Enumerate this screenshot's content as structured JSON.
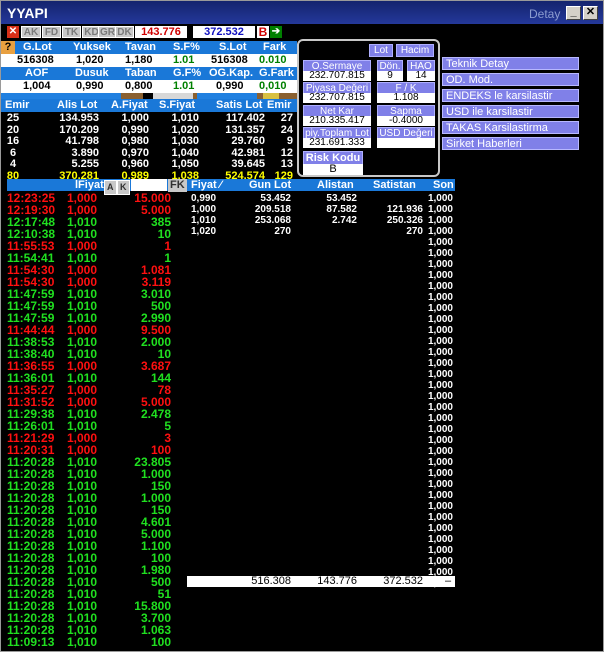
{
  "title": {
    "symbol": "YYAPI",
    "detail": "Detay"
  },
  "toolbar": {
    "x": "✕",
    "tabs": [
      "AK",
      "FD",
      "TK",
      "KD",
      "GR",
      "DK"
    ],
    "last_volume": "143.776",
    "last_value": "372.532",
    "b": "B",
    "arrow": "➔"
  },
  "summary": {
    "row1_headers": [
      "G.Lot",
      "Yuksek",
      "Tavan",
      "S.F%",
      "S.Lot",
      "Fark"
    ],
    "row1_values": [
      "516308",
      "1,020",
      "1,180",
      "1.01",
      "516308",
      "0.010"
    ],
    "row2_headers": [
      "AOF",
      "Dusuk",
      "Taban",
      "G.F%",
      "OG.Kap.",
      "G.Fark"
    ],
    "row2_values": [
      "1,004",
      "0,990",
      "0,800",
      "1.01",
      "0,990",
      "0,010"
    ],
    "help_icon": "?"
  },
  "depth": {
    "headers": [
      "Emir",
      "Alis Lot",
      "A.Fiyat",
      "S.Fiyat",
      "Satis Lot",
      "Emir"
    ],
    "rows": [
      [
        "25",
        "134.953",
        "1,000",
        "1,010",
        "117.402",
        "27"
      ],
      [
        "20",
        "170.209",
        "0,990",
        "1,020",
        "131.357",
        "24"
      ],
      [
        "16",
        "41.798",
        "0,980",
        "1,030",
        "29.760",
        "9"
      ],
      [
        "6",
        "3.890",
        "0,970",
        "1,040",
        "42.981",
        "12"
      ],
      [
        "4",
        "5.255",
        "0,960",
        "1,050",
        "39.645",
        "13"
      ]
    ],
    "total": [
      "80",
      "370.281",
      "0,989",
      "1,038",
      "524.574",
      "129"
    ]
  },
  "panel": {
    "lot": "Lot",
    "hacim": "Hacim",
    "osermaye_label": "O.Sermaye",
    "osermaye_value": "232.707.815",
    "don_label": "Dön.",
    "don_value": "9",
    "hao_label": "HAO",
    "hao_value": "14",
    "piyasa_label": "Piyasa Değeri",
    "piyasa_value": "232.707.815",
    "fk_label": "F / K",
    "fk_value": "1.108",
    "netkar_label": "Net Kar",
    "netkar_value": "210.335.417",
    "sapma_label": "Sapma",
    "sapma_value": "-0.4000",
    "toplam_label": "piy.Toplam Lot",
    "toplam_value": "231.691.333",
    "usd_label": "USD Değeri",
    "usd_value": "",
    "risk_label": "Risk Kodu",
    "risk_value": "B"
  },
  "menu": [
    "Teknik Detay",
    "OD. Mod.",
    "ENDEKS le karsilastir",
    "USD ile karsilastir",
    "TAKAS Karsilastirma",
    "Sirket Haberleri"
  ],
  "trades": {
    "headers": {
      "fiyat": "lFiyat",
      "a": "A",
      "k": "K",
      "fk": "FK"
    },
    "rows": [
      [
        "12:23:25",
        "1,000",
        "15.000",
        "red"
      ],
      [
        "12:19:30",
        "1,000",
        "5.000",
        "red"
      ],
      [
        "12:17:48",
        "1,010",
        "385",
        "green"
      ],
      [
        "12:10:38",
        "1,010",
        "10",
        "green"
      ],
      [
        "11:55:53",
        "1,000",
        "1",
        "red"
      ],
      [
        "11:54:41",
        "1,010",
        "1",
        "green"
      ],
      [
        "11:54:30",
        "1,000",
        "1.081",
        "red"
      ],
      [
        "11:54:30",
        "1,000",
        "3.119",
        "red"
      ],
      [
        "11:47:59",
        "1,010",
        "3.010",
        "green"
      ],
      [
        "11:47:59",
        "1,010",
        "500",
        "green"
      ],
      [
        "11:47:59",
        "1,010",
        "2.990",
        "green"
      ],
      [
        "11:44:44",
        "1,000",
        "9.500",
        "red"
      ],
      [
        "11:38:53",
        "1,010",
        "2.000",
        "green"
      ],
      [
        "11:38:40",
        "1,010",
        "10",
        "green"
      ],
      [
        "11:36:55",
        "1,000",
        "3.687",
        "red"
      ],
      [
        "11:36:01",
        "1,010",
        "144",
        "green"
      ],
      [
        "11:35:27",
        "1,000",
        "78",
        "red"
      ],
      [
        "11:31:52",
        "1,000",
        "5.000",
        "red"
      ],
      [
        "11:29:38",
        "1,010",
        "2.478",
        "green"
      ],
      [
        "11:26:01",
        "1,010",
        "5",
        "green"
      ],
      [
        "11:21:29",
        "1,000",
        "3",
        "red"
      ],
      [
        "11:20:31",
        "1,000",
        "100",
        "red"
      ],
      [
        "11:20:28",
        "1,010",
        "23.805",
        "green"
      ],
      [
        "11:20:28",
        "1,010",
        "1.000",
        "green"
      ],
      [
        "11:20:28",
        "1,010",
        "150",
        "green"
      ],
      [
        "11:20:28",
        "1,010",
        "1.000",
        "green"
      ],
      [
        "11:20:28",
        "1,010",
        "150",
        "green"
      ],
      [
        "11:20:28",
        "1,010",
        "4.601",
        "green"
      ],
      [
        "11:20:28",
        "1,010",
        "5.000",
        "green"
      ],
      [
        "11:20:28",
        "1,010",
        "1.100",
        "green"
      ],
      [
        "11:20:28",
        "1,010",
        "100",
        "green"
      ],
      [
        "11:20:28",
        "1,010",
        "1.980",
        "green"
      ],
      [
        "11:20:28",
        "1,010",
        "500",
        "green"
      ],
      [
        "11:20:28",
        "1,010",
        "51",
        "green"
      ],
      [
        "11:20:28",
        "1,010",
        "15.800",
        "green"
      ],
      [
        "11:20:28",
        "1,010",
        "3.700",
        "green"
      ],
      [
        "11:20:28",
        "1,010",
        "1.063",
        "green"
      ],
      [
        "11:09:13",
        "1,010",
        "100",
        "green"
      ]
    ]
  },
  "price_table": {
    "headers": [
      "Fiyat ⁄",
      "Gun Lot",
      "Alistan",
      "Satistan",
      "Son"
    ],
    "rows": [
      [
        "0,990",
        "53.452",
        "53.452",
        "",
        "1,000"
      ],
      [
        "1,000",
        "209.518",
        "87.582",
        "121.936",
        "1,000"
      ],
      [
        "1,010",
        "253.068",
        "2.742",
        "250.326",
        "1,000"
      ],
      [
        "1,020",
        "270",
        "",
        "270",
        "1,000"
      ]
    ],
    "son_extra": [
      "1,000",
      "1,000",
      "1,000",
      "1,000",
      "1,000",
      "1,000",
      "1,000",
      "1,000",
      "1,000",
      "1,000",
      "1,000",
      "1,000",
      "1,000",
      "1,000",
      "1,000",
      "1,000",
      "1,000",
      "1,000",
      "1,000",
      "1,000",
      "1,000",
      "1,000",
      "1,000",
      "1,000",
      "1,000",
      "1,000",
      "1,000",
      "1,000",
      "1,000",
      "1,000",
      "1,000",
      "1,000"
    ],
    "totals": [
      "516.308",
      "143.776",
      "372.532",
      "–"
    ]
  },
  "colors": {
    "red": "#ff1010",
    "green": "#20e020",
    "blue": "#1a78d8",
    "menu": "#8080e8"
  }
}
